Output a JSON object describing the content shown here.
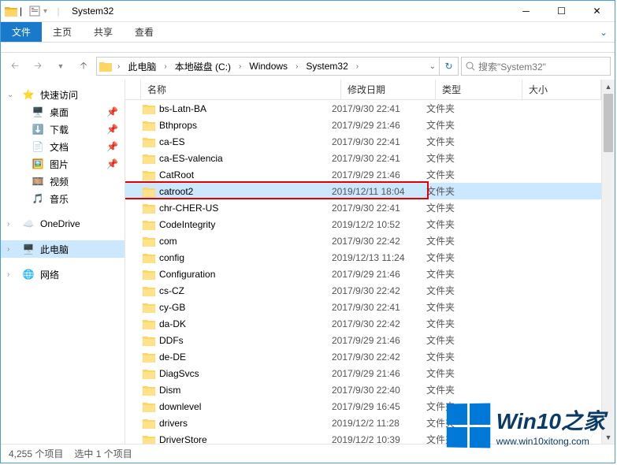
{
  "window": {
    "title": "System32"
  },
  "ribbon": {
    "file": "文件",
    "tabs": [
      "主页",
      "共享",
      "查看"
    ]
  },
  "breadcrumbs": [
    "此电脑",
    "本地磁盘 (C:)",
    "Windows",
    "System32"
  ],
  "nav_buttons": {
    "dropdown_label": "▼"
  },
  "search": {
    "placeholder": "搜索\"System32\""
  },
  "columns": {
    "name": "名称",
    "date": "修改日期",
    "type": "类型",
    "size": "大小"
  },
  "quick_access": {
    "label": "快速访问",
    "items": [
      {
        "label": "桌面",
        "icon": "desktop",
        "pinned": true
      },
      {
        "label": "下载",
        "icon": "download",
        "pinned": true
      },
      {
        "label": "文档",
        "icon": "document",
        "pinned": true
      },
      {
        "label": "图片",
        "icon": "picture",
        "pinned": true
      },
      {
        "label": "视频",
        "icon": "video",
        "pinned": false
      },
      {
        "label": "音乐",
        "icon": "music",
        "pinned": false
      }
    ]
  },
  "onedrive": {
    "label": "OneDrive"
  },
  "thispc": {
    "label": "此电脑"
  },
  "network": {
    "label": "网络"
  },
  "files": [
    {
      "name": "bs-Latn-BA",
      "date": "2017/9/30 22:41",
      "type": "文件夹",
      "selected": false
    },
    {
      "name": "Bthprops",
      "date": "2017/9/29 21:46",
      "type": "文件夹",
      "selected": false
    },
    {
      "name": "ca-ES",
      "date": "2017/9/30 22:41",
      "type": "文件夹",
      "selected": false
    },
    {
      "name": "ca-ES-valencia",
      "date": "2017/9/30 22:41",
      "type": "文件夹",
      "selected": false
    },
    {
      "name": "CatRoot",
      "date": "2017/9/29 21:46",
      "type": "文件夹",
      "selected": false
    },
    {
      "name": "catroot2",
      "date": "2019/12/11 18:04",
      "type": "文件夹",
      "selected": true,
      "highlight": true
    },
    {
      "name": "chr-CHER-US",
      "date": "2017/9/30 22:41",
      "type": "文件夹",
      "selected": false
    },
    {
      "name": "CodeIntegrity",
      "date": "2019/12/2 10:52",
      "type": "文件夹",
      "selected": false
    },
    {
      "name": "com",
      "date": "2017/9/30 22:42",
      "type": "文件夹",
      "selected": false
    },
    {
      "name": "config",
      "date": "2019/12/13 11:24",
      "type": "文件夹",
      "selected": false
    },
    {
      "name": "Configuration",
      "date": "2017/9/29 21:46",
      "type": "文件夹",
      "selected": false
    },
    {
      "name": "cs-CZ",
      "date": "2017/9/30 22:42",
      "type": "文件夹",
      "selected": false
    },
    {
      "name": "cy-GB",
      "date": "2017/9/30 22:41",
      "type": "文件夹",
      "selected": false
    },
    {
      "name": "da-DK",
      "date": "2017/9/30 22:42",
      "type": "文件夹",
      "selected": false
    },
    {
      "name": "DDFs",
      "date": "2017/9/29 21:46",
      "type": "文件夹",
      "selected": false
    },
    {
      "name": "de-DE",
      "date": "2017/9/30 22:42",
      "type": "文件夹",
      "selected": false
    },
    {
      "name": "DiagSvcs",
      "date": "2017/9/29 21:46",
      "type": "文件夹",
      "selected": false
    },
    {
      "name": "Dism",
      "date": "2017/9/30 22:40",
      "type": "文件夹",
      "selected": false
    },
    {
      "name": "downlevel",
      "date": "2017/9/29 16:45",
      "type": "文件夹",
      "selected": false
    },
    {
      "name": "drivers",
      "date": "2019/12/2 11:28",
      "type": "文件夹",
      "selected": false
    },
    {
      "name": "DriverStore",
      "date": "2019/12/2 10:39",
      "type": "文件夹",
      "selected": false
    }
  ],
  "status": {
    "count": "4,255 个项目",
    "selected": "选中 1 个项目"
  },
  "watermark": {
    "text": "Win10",
    "suffix": "之家",
    "url": "www.win10xitong.com"
  }
}
